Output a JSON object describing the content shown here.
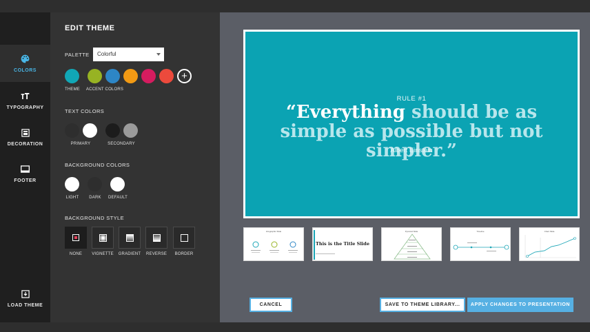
{
  "rail": {
    "items": [
      {
        "label": "COLORS",
        "icon": "palette-icon"
      },
      {
        "label": "TYPOGRAPHY",
        "icon": "typography-icon"
      },
      {
        "label": "DECORATION",
        "icon": "decoration-icon"
      },
      {
        "label": "FOOTER",
        "icon": "footer-icon"
      }
    ],
    "load_theme": {
      "label": "LOAD THEME",
      "icon": "load-theme-icon"
    }
  },
  "panel": {
    "title": "EDIT THEME",
    "palette_label": "PALETTE",
    "palette_value": "Colorful",
    "palette_colors": [
      "#11a7b6",
      "#97b323",
      "#2d86c6",
      "#f29a14",
      "#d51c5f",
      "#ec4a3c"
    ],
    "theme_caption": "THEME",
    "accent_caption": "ACCENT COLORS",
    "add_color_glyph": "+",
    "text_colors_label": "TEXT COLORS",
    "text_colors": [
      "#2e2e2e",
      "#ffffff",
      "#1c1c1c",
      "#9b9b9b"
    ],
    "primary_caption": "PRIMARY",
    "secondary_caption": "SECONDARY",
    "background_colors_label": "BACKGROUND COLORS",
    "background_colors": [
      "#ffffff",
      "#2e2e2e",
      "#ffffff"
    ],
    "bg_captions": [
      "LIGHT",
      "DARK",
      "DEFAULT"
    ],
    "background_style_label": "BACKGROUND STYLE",
    "bg_styles": [
      "NONE",
      "VIGNETTE",
      "GRADIENT",
      "REVERSE",
      "BORDER"
    ],
    "selected_bg_style": "NONE"
  },
  "slide": {
    "rule": "RULE #1",
    "quote_lead": "“Everything",
    "quote_rest": " should be as simple as possible but not simpler.”",
    "author": "Albert Einstein",
    "background": "#0ba3b3"
  },
  "thumbnails": [
    {
      "title": "Infographic Slide"
    },
    {
      "title": "This is the Title Slide"
    },
    {
      "title": "Pyramid Slide"
    },
    {
      "title": "Timeline"
    },
    {
      "title": "Chart Slide"
    }
  ],
  "buttons": {
    "cancel": "CANCEL",
    "save": "SAVE TO THEME LIBRARY...",
    "apply": "APPLY CHANGES TO PRESENTATION"
  },
  "accent": "#56b0e3"
}
